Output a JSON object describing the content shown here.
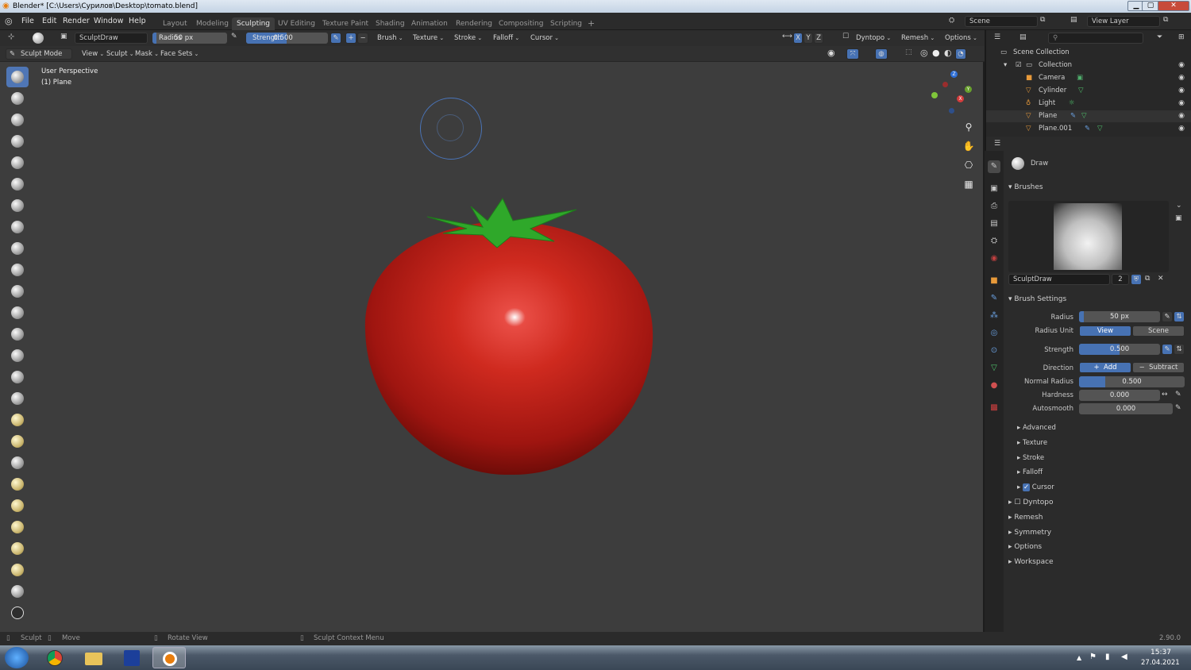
{
  "window": {
    "title": "Blender* [C:\\Users\\Сурилов\\Desktop\\tomato.blend]",
    "min": "▁",
    "max": "▢",
    "close": "✕"
  },
  "menu": [
    "File",
    "Edit",
    "Render",
    "Window",
    "Help"
  ],
  "workspaces": [
    "Layout",
    "Modeling",
    "Sculpting",
    "UV Editing",
    "Texture Paint",
    "Shading",
    "Animation",
    "Rendering",
    "Compositing",
    "Scripting"
  ],
  "active_workspace": "Sculpting",
  "add_workspace": "+",
  "scene": {
    "label": "Scene"
  },
  "view_layer": {
    "label": "View Layer"
  },
  "tool_header": {
    "brush_name": "SculptDraw",
    "radius_label": "Radius",
    "radius_value": "50 px",
    "strength_label": "Strength",
    "strength_value": "0.500",
    "plus": "+",
    "minus": "−",
    "menus": [
      "Brush",
      "Texture",
      "Stroke",
      "Falloff",
      "Cursor"
    ],
    "axes": [
      "X",
      "Y",
      "Z"
    ],
    "dyntopo": "Dyntopo",
    "remesh": "Remesh",
    "options": "Options"
  },
  "mode_header": {
    "mode": "Sculpt Mode",
    "menus": [
      "View",
      "Sculpt",
      "Mask",
      "Face Sets"
    ]
  },
  "viewport": {
    "perspective": "User Perspective",
    "object": "(1) Plane",
    "gizmo": {
      "x": "X",
      "y": "Y",
      "z": "Z"
    }
  },
  "outliner": {
    "root": "Scene Collection",
    "collection": "Collection",
    "items": [
      "Camera",
      "Cylinder",
      "Light",
      "Plane",
      "Plane.001"
    ]
  },
  "properties": {
    "active_tool": "Draw",
    "brushes_section": "Brushes",
    "brush_name": "SculptDraw",
    "brush_users": "2",
    "brush_settings_section": "Brush Settings",
    "radius": {
      "label": "Radius",
      "value": "50 px",
      "fill": 0.0
    },
    "radius_unit": {
      "label": "Radius Unit",
      "view": "View",
      "scene": "Scene"
    },
    "strength": {
      "label": "Strength",
      "value": "0.500",
      "fill": 0.5
    },
    "direction": {
      "label": "Direction",
      "add": "Add",
      "subtract": "Subtract"
    },
    "normal_radius": {
      "label": "Normal Radius",
      "value": "0.500",
      "fill": 0.25
    },
    "hardness": {
      "label": "Hardness",
      "value": "0.000",
      "fill": 0.0
    },
    "autosmooth": {
      "label": "Autosmooth",
      "value": "0.000",
      "fill": 0.0
    },
    "subsections": [
      "Advanced",
      "Texture",
      "Stroke",
      "Falloff",
      "Cursor"
    ],
    "sections": [
      "Dyntopo",
      "Remesh",
      "Symmetry",
      "Options",
      "Workspace"
    ]
  },
  "status": {
    "sculpt": "Sculpt",
    "move": "Move",
    "rotate": "Rotate View",
    "context": "Sculpt Context Menu",
    "version": "2.90.0"
  },
  "taskbar": {
    "time": "15:37",
    "date": "27.04.2021"
  },
  "colors": {
    "accent": "#4772b3",
    "tomato": "#c0201a",
    "stem": "#2fa82a"
  }
}
